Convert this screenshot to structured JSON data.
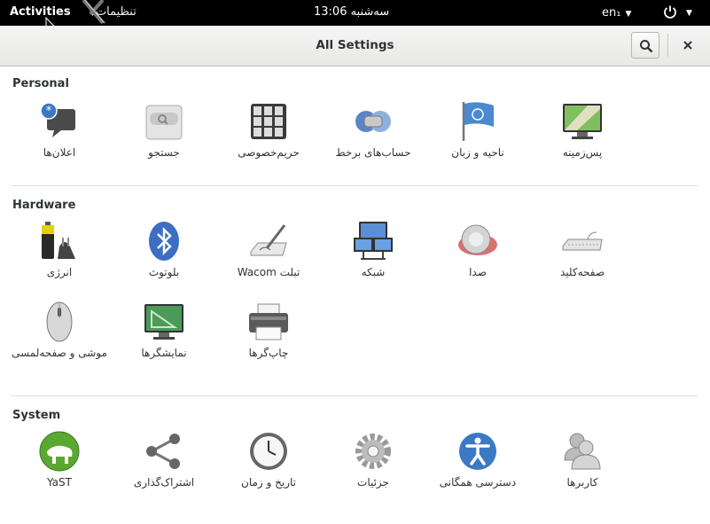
{
  "topbar": {
    "activities": "Activities",
    "app_menu": "تنظیمات",
    "clock": "سه‌شنبه 13:06",
    "lang": "en₁"
  },
  "window": {
    "title": "All Settings"
  },
  "sections": {
    "personal": {
      "title": "Personal",
      "items": [
        "اعلان‌ها",
        "جستجو",
        "حریم‌خصوصی",
        "حساب‌های برخط",
        "ناحیه و زبان",
        "پس‌زمینه"
      ]
    },
    "hardware": {
      "title": "Hardware",
      "items": [
        "انرژی",
        "بلوتوث",
        "تبلت Wacom",
        "شبکه",
        "صدا",
        "صفحه‌کلید",
        "موشی و صفحه‌لمسی",
        "نمایشگرها",
        "چاپ‌گرها"
      ]
    },
    "system": {
      "title": "System",
      "items": [
        "YaST",
        "اشتراک‌گذاری",
        "تاریخ و زمان",
        "جزئیات",
        "دسترسی همگانی",
        "کاربرها"
      ]
    }
  },
  "colors": {
    "topbar": "#000000",
    "header": "#ededed",
    "accent": "#3c79c5"
  }
}
